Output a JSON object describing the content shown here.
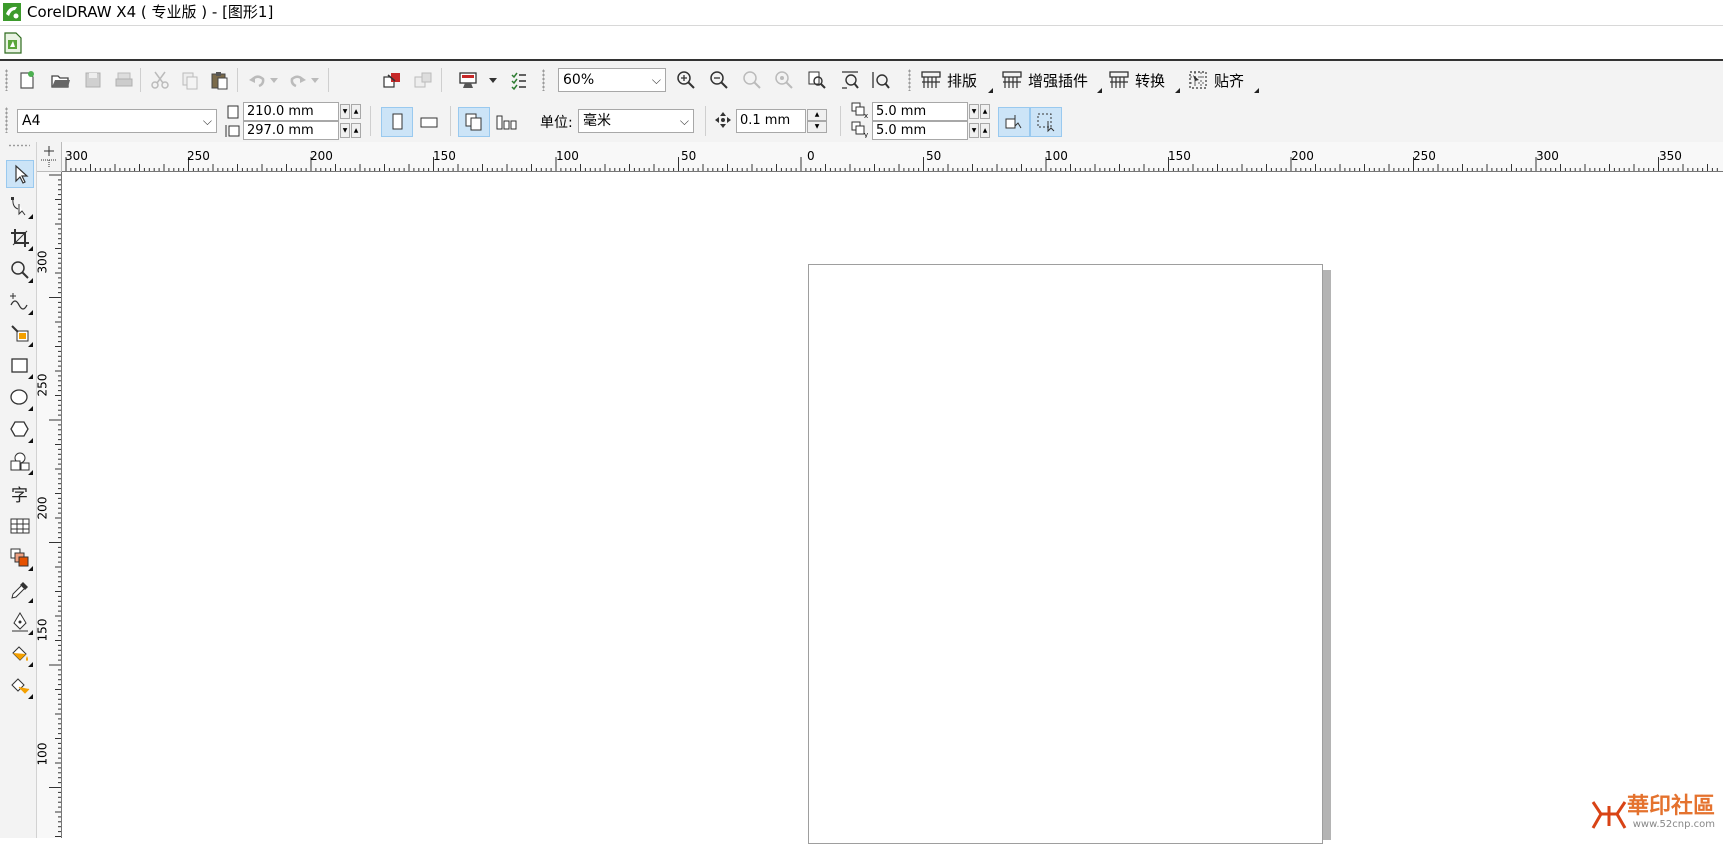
{
  "window": {
    "title": "CorelDRAW X4 ( 专业版 ) - [图形1]"
  },
  "toolbar_standard": {
    "zoom_value": "60%",
    "menus": [
      {
        "label": "排版"
      },
      {
        "label": "增强插件"
      },
      {
        "label": "转换"
      },
      {
        "label": "贴齐"
      }
    ]
  },
  "property_bar": {
    "paper_size": "A4",
    "page_width": "210.0 mm",
    "page_height": "297.0 mm",
    "units_label": "单位:",
    "units_value": "毫米",
    "nudge_distance": "0.1 mm",
    "duplicate_x": "5.0 mm",
    "duplicate_y": "5.0 mm"
  },
  "rulers": {
    "horizontal_labels": [
      "300",
      "250",
      "200",
      "150",
      "100",
      "50",
      "0",
      "50",
      "100",
      "150",
      "200",
      "250",
      "300",
      "350"
    ],
    "vertical_labels": [
      "300",
      "250",
      "200",
      "150",
      "100"
    ]
  },
  "watermark": {
    "brand": "華印社區",
    "url": "www.52cnp.com"
  },
  "colors": {
    "accent": "#cce4f7",
    "accent_border": "#99c9ef",
    "toolbar_bg": "#f3f3f3",
    "page_shadow": "#b4b4b4"
  }
}
